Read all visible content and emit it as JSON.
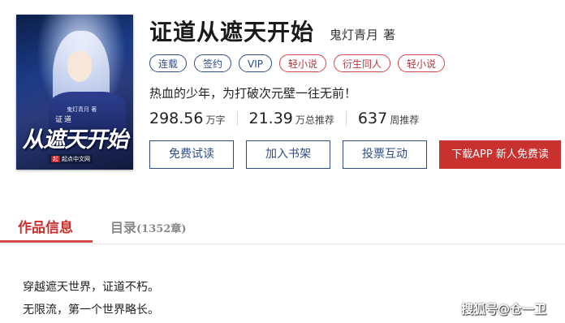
{
  "book": {
    "title": "证道从遮天开始",
    "author": "鬼灯青月",
    "author_suffix": "著",
    "tags": [
      {
        "label": "连载",
        "style": "blue"
      },
      {
        "label": "签约",
        "style": "blue"
      },
      {
        "label": "VIP",
        "style": "blue"
      },
      {
        "label": "轻小说",
        "style": "red"
      },
      {
        "label": "衍生同人",
        "style": "red"
      },
      {
        "label": "轻小说",
        "style": "red"
      }
    ],
    "tagline": "热血的少年，为打破次元壁一往无前！",
    "stats": [
      {
        "value": "298.56",
        "unit": "万字"
      },
      {
        "value": "21.39",
        "unit": "万总推荐"
      },
      {
        "value": "637",
        "unit": "周推荐"
      }
    ]
  },
  "cover": {
    "author_small": "鬼灯青月 著",
    "small_title": "证道",
    "big_title": "从遮天开始",
    "publisher_mark": "起",
    "publisher": "起点中文网"
  },
  "actions": {
    "trial_label": "免费试读",
    "shelf_label": "加入书架",
    "vote_label": "投票互动",
    "download_label": "下载APP 新人免费读"
  },
  "tabs": {
    "info_label": "作品信息",
    "toc_label": "目录",
    "toc_count": "(1352章)"
  },
  "intro": {
    "line1": "穿越遮天世界，证道不朽。",
    "line2": "无限流，第一个世界略长。"
  },
  "watermark": "搜狐号@仓一卫",
  "colors": {
    "accent_red": "#c8312e",
    "tag_blue": "#2f4c86",
    "tag_red": "#d7444a"
  }
}
